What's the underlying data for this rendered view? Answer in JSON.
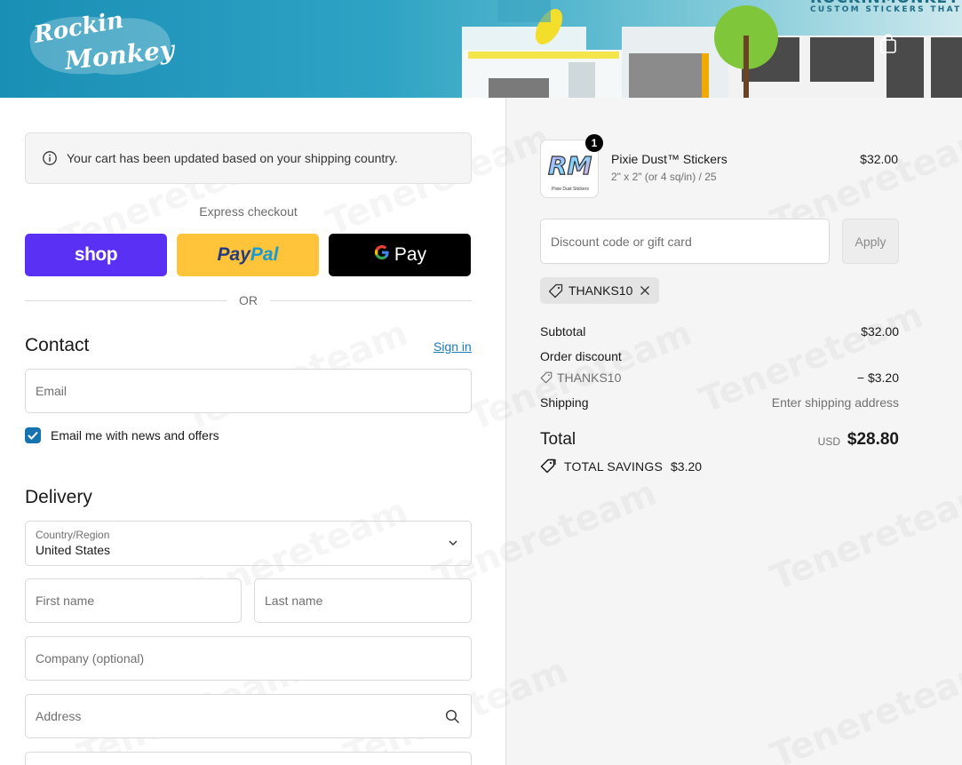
{
  "header": {
    "logo_line1": "Rockin",
    "logo_line2": "Monkey",
    "brand_name": "ROCKINMONKEY",
    "tagline": "CUSTOM STICKERS THAT ROC",
    "cart_icon": "shopping-bag-icon"
  },
  "notice": {
    "icon": "info-icon",
    "text": "Your cart has been updated based on your shipping country."
  },
  "express": {
    "title": "Express checkout",
    "shop_label": "shop",
    "paypal_label_1": "Pay",
    "paypal_label_2": "Pal",
    "gpay_g": "G",
    "gpay_label": "Pay",
    "or_text": "OR"
  },
  "contact": {
    "title": "Contact",
    "sign_in": "Sign in",
    "email_placeholder": "Email",
    "newsletter_label": "Email me with news and offers",
    "newsletter_checked": true
  },
  "delivery": {
    "title": "Delivery",
    "country_label": "Country/Region",
    "country_value": "United States",
    "first_name_placeholder": "First name",
    "last_name_placeholder": "Last name",
    "company_placeholder": "Company (optional)",
    "address_placeholder": "Address"
  },
  "order": {
    "product": {
      "thumb_letters": "RM",
      "thumb_caption": "Pixie Dust Stickers",
      "quantity": "1",
      "name": "Pixie Dust™ Stickers",
      "variant": "2\" x 2\" (or 4 sq/in) / 25",
      "price": "$32.00"
    },
    "discount_placeholder": "Discount code or gift card",
    "apply_label": "Apply",
    "code": "THANKS10",
    "subtotal_label": "Subtotal",
    "subtotal_value": "$32.00",
    "order_discount_label": "Order discount",
    "discount_code": "THANKS10",
    "discount_value": "− $3.20",
    "shipping_label": "Shipping",
    "shipping_value": "Enter shipping address",
    "total_label": "Total",
    "currency": "USD",
    "total_value": "$28.80",
    "savings_label": "TOTAL SAVINGS",
    "savings_value": "$3.20"
  },
  "colors": {
    "shop": "#5a31f4",
    "paypal": "#ffc439",
    "link": "#197bbd",
    "checkbox": "#1773b0"
  }
}
